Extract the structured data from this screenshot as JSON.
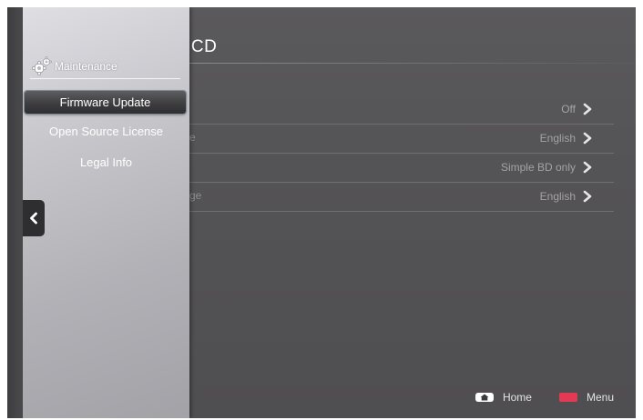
{
  "background_page": {
    "title_fragment": "o CD",
    "settings": [
      {
        "label_fragment": "",
        "value": "Off"
      },
      {
        "label_fragment": "e",
        "value": "English"
      },
      {
        "label_fragment": "",
        "value": "Simple BD only"
      },
      {
        "label_fragment": "ge",
        "value": "English"
      }
    ]
  },
  "panel": {
    "icon": "gear-icon",
    "title": "Maintenance",
    "items": [
      {
        "label": "Firmware Update",
        "selected": true
      },
      {
        "label": "Open Source License",
        "selected": false
      },
      {
        "label": "Legal Info",
        "selected": false
      }
    ],
    "back_icon": "chevron-left-icon"
  },
  "footer": {
    "home_label": "Home",
    "menu_label": "Menu",
    "home_icon": "home-icon",
    "menu_key_color": "#e23a55"
  }
}
